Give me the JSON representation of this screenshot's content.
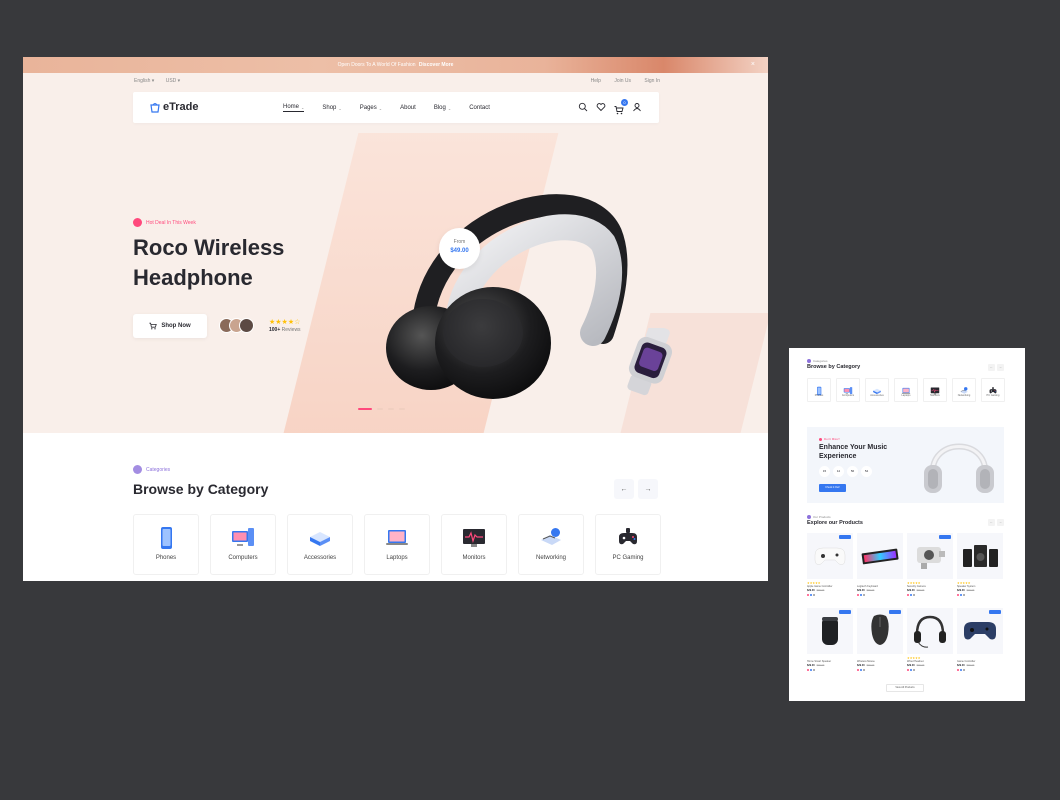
{
  "main": {
    "announcement": {
      "text": "Open Doors To A World Of Fashion",
      "cta": "Discover More",
      "close": "×"
    },
    "topbar": {
      "language": "English ▾",
      "currency": "USD ▾",
      "links": [
        "Help",
        "Join Us",
        "Sign In"
      ]
    },
    "logo": "eTrade",
    "nav": [
      {
        "label": "Home",
        "active": true,
        "dropdown": true
      },
      {
        "label": "Shop",
        "active": false,
        "dropdown": true
      },
      {
        "label": "Pages",
        "active": false,
        "dropdown": true
      },
      {
        "label": "About",
        "active": false,
        "dropdown": false
      },
      {
        "label": "Blog",
        "active": false,
        "dropdown": true
      },
      {
        "label": "Contact",
        "active": false,
        "dropdown": false
      }
    ],
    "nav_icons": [
      "search-icon",
      "heart-icon",
      "cart-icon",
      "user-icon"
    ],
    "cart_count": "0",
    "hero": {
      "badge": "Hot Deal In This Week",
      "title": "Roco Wireless Headphone",
      "shop_button": "Shop Now",
      "rating_stars": "★★★★☆",
      "reviews_count": "100+",
      "reviews_label": "Reviews",
      "price_from": "From",
      "price": "$49.00"
    },
    "categories": {
      "label": "Categories",
      "title": "Browse by Category",
      "prev": "←",
      "next": "→",
      "items": [
        "Phones",
        "Computers",
        "Accessories",
        "Laptops",
        "Monitors",
        "Networking",
        "PC Gaming"
      ]
    }
  },
  "side": {
    "categories_label": "Categories",
    "categories_title": "Browse by Category",
    "categories": [
      "Phones",
      "Computers",
      "Accessories",
      "Laptops",
      "Monitors",
      "Networking",
      "PC Gaming"
    ],
    "banner": {
      "label": "Don't Miss!!",
      "title": "Enhance Your Music Experience",
      "timer": [
        "15",
        "12",
        "56",
        "54"
      ],
      "button": "Check it Out!"
    },
    "products_label": "Our Products",
    "products_title": "Explore our Products",
    "products": [
      {
        "name": "Apple Game Controller",
        "price": "$29.00",
        "old": "$30.00",
        "stars": "★★★★★",
        "tag": true
      },
      {
        "name": "Logitech Keyboard",
        "price": "$29.00",
        "old": "$30.00",
        "stars": "",
        "tag": false
      },
      {
        "name": "Security Camera",
        "price": "$29.00",
        "old": "$30.00",
        "stars": "★★★★★",
        "tag": true
      },
      {
        "name": "Speaker System",
        "price": "$29.00",
        "old": "$30.00",
        "stars": "★★★★★",
        "tag": false
      },
      {
        "name": "Home Smart Speaker",
        "price": "$29.00",
        "old": "$30.00",
        "stars": "",
        "tag": true
      },
      {
        "name": "Wireless Mouse",
        "price": "$29.00",
        "old": "$30.00",
        "stars": "",
        "tag": true
      },
      {
        "name": "Wired Headset",
        "price": "$29.00",
        "old": "$30.00",
        "stars": "★★★★★",
        "tag": false
      },
      {
        "name": "Game Controller",
        "price": "$29.00",
        "old": "$30.00",
        "stars": "",
        "tag": true
      }
    ],
    "view_all": "View All Products"
  },
  "colors": {
    "accent": "#3577f0",
    "pink": "#ff497c",
    "purple": "#8c71db",
    "hero_bg": "#f9efea",
    "page_bg": "#38393c"
  }
}
